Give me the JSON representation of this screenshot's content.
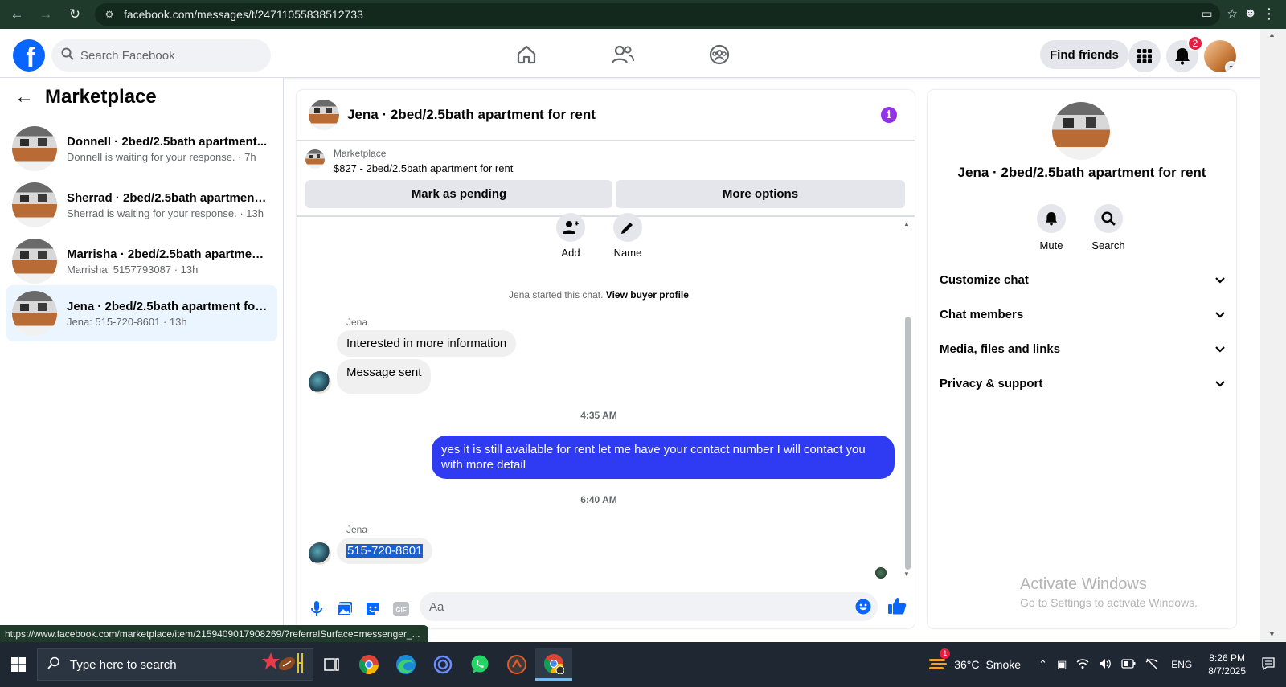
{
  "browser": {
    "url": "facebook.com/messages/t/24711055838512733"
  },
  "fb_header": {
    "search_placeholder": "Search Facebook",
    "find_friends": "Find friends",
    "notification_count": "2"
  },
  "sidebar": {
    "title": "Marketplace",
    "conversations": [
      {
        "name": "Donnell · 2bed/2.5bath apartment...",
        "sub": "Donnell is waiting for your response. · 7h"
      },
      {
        "name": "Sherrad · 2bed/2.5bath apartment...",
        "sub": "Sherrad is waiting for your response. · 13h"
      },
      {
        "name": "Marrisha · 2bed/2.5bath apartmen...",
        "sub": "Marrisha: 5157793087 · 13h"
      },
      {
        "name": "Jena · 2bed/2.5bath apartment for...",
        "sub": "Jena: 515-720-8601 · 13h"
      }
    ]
  },
  "chat": {
    "title": "Jena · 2bed/2.5bath apartment for rent",
    "listing_label": "Marketplace",
    "listing_price": "$827 - 2bed/2.5bath apartment for rent",
    "mark_pending": "Mark as pending",
    "more_options": "More options",
    "quick_add": "Add",
    "quick_name": "Name",
    "started_text": "Jena started this chat.",
    "view_buyer": "View buyer profile",
    "sender1": "Jena",
    "msg1": "Interested in more information",
    "msg2": "Message sent",
    "time1": "4:35 AM",
    "msg_out": "yes it is still available for rent let me have your contact number I will contact you with more detail",
    "time2": "6:40 AM",
    "sender2": "Jena",
    "msg3": "515-720-8601",
    "composer_placeholder": "Aa"
  },
  "info_panel": {
    "title": "Jena · 2bed/2.5bath apartment for rent",
    "mute": "Mute",
    "search": "Search",
    "sections": [
      "Customize chat",
      "Chat members",
      "Media, files and links",
      "Privacy & support"
    ],
    "activate_line1": "Activate Windows",
    "activate_line2": "Go to Settings to activate Windows."
  },
  "status_url": "https://www.facebook.com/marketplace/item/2159409017908269/?referralSurface=messenger_...",
  "taskbar": {
    "search_placeholder": "Type here to search",
    "weather_temp": "36°C",
    "weather_desc": "Smoke",
    "lang": "ENG",
    "time": "8:26 PM",
    "date": "8/7/2025",
    "weather_badge": "1"
  },
  "colors": {
    "fb_blue": "#0866ff",
    "outgoing_bubble": "#2f3bf3",
    "info_purple": "#9333ea",
    "active_conv": "#ebf5ff"
  }
}
